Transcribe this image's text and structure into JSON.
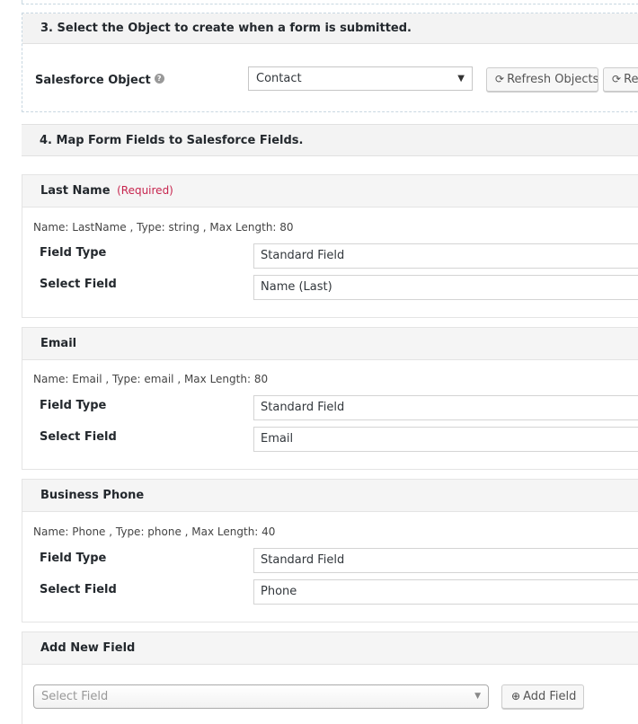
{
  "section3": {
    "title": "3. Select the Object to create when a form is submitted.",
    "object_label": "Salesforce Object",
    "help_icon": "question-circle-icon",
    "selected_object": "Contact",
    "refresh_objects_label": "Refresh Objects",
    "refresh_fields_label_truncated": "Re"
  },
  "section4": {
    "title": "4. Map Form Fields to Salesforce Fields."
  },
  "mappings": [
    {
      "name": "Last Name",
      "required_label": "(Required)",
      "meta": "Name: LastName , Type: string , Max Length: 80",
      "field_type_label": "Field Type",
      "field_type_value": "Standard Field",
      "select_field_label": "Select Field",
      "select_field_value": "Name (Last)"
    },
    {
      "name": "Email",
      "meta": "Name: Email , Type: email , Max Length: 80",
      "field_type_label": "Field Type",
      "field_type_value": "Standard Field",
      "select_field_label": "Select Field",
      "select_field_value": "Email"
    },
    {
      "name": "Business Phone",
      "meta": "Name: Phone , Type: phone , Max Length: 40",
      "field_type_label": "Field Type",
      "field_type_value": "Standard Field",
      "select_field_label": "Select Field",
      "select_field_value": "Phone"
    }
  ],
  "add_new": {
    "title": "Add New Field",
    "select_placeholder": "Select Field",
    "button_label": "Add Field"
  }
}
